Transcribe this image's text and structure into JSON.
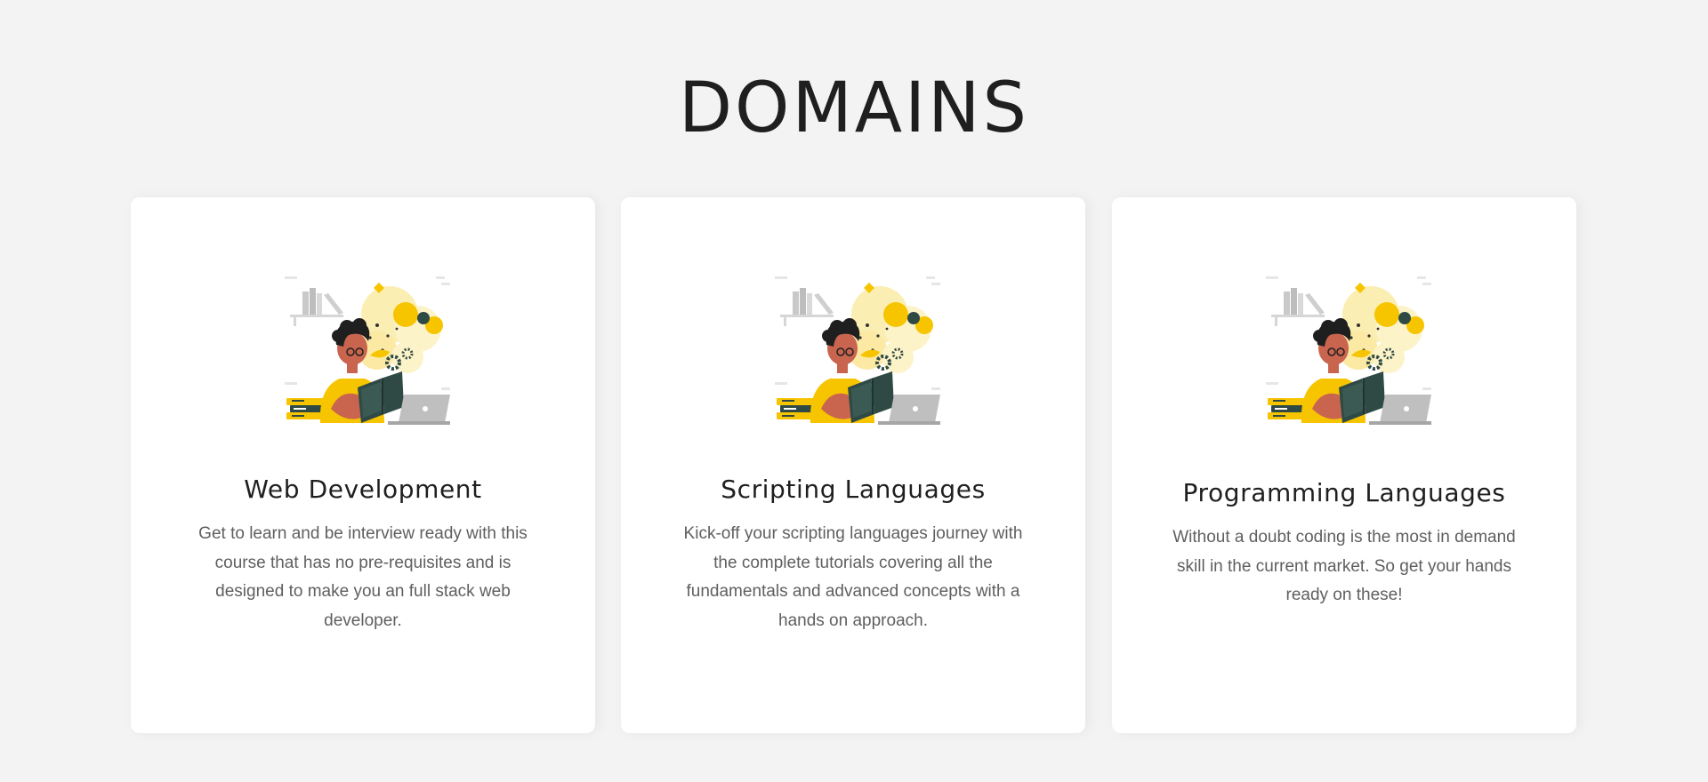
{
  "section": {
    "title": "DOMAINS"
  },
  "colors": {
    "page_background": "#f3f3f3",
    "card_background": "#ffffff",
    "title_text": "#1f1f1f",
    "body_text": "#5f5f5f",
    "accent_yellow": "#f7c400",
    "skin": "#c9654e",
    "dark_green": "#2f4a45"
  },
  "cards": [
    {
      "title": "Web Development",
      "description": "Get to learn and be interview ready with this course that has no pre-requisites and is designed to make you an full stack web developer.",
      "illustration": "student-reading-book-illustration"
    },
    {
      "title": "Scripting Languages",
      "description": "Kick-off your scripting languages journey with the complete tutorials covering all the fundamentals and advanced concepts with a hands on approach.",
      "illustration": "student-reading-book-illustration"
    },
    {
      "title": "Programming Languages",
      "description": "Without a doubt coding is the most in demand skill in the current market. So get your hands ready on these!",
      "illustration": "student-reading-book-illustration"
    }
  ]
}
